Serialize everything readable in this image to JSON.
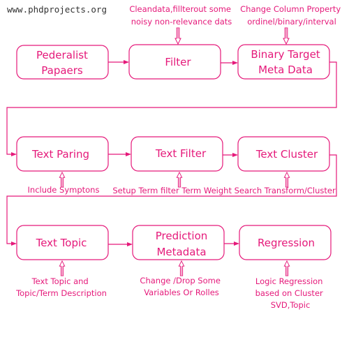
{
  "watermark": "www.phdprojects.org",
  "accent_color": "#e5197a",
  "nodes": [
    {
      "lines": [
        "Pederalist",
        "Papaers"
      ]
    },
    {
      "lines": [
        "Filter"
      ]
    },
    {
      "lines": [
        "Binary Target",
        "Meta Data"
      ]
    },
    {
      "lines": [
        "Text Paring"
      ]
    },
    {
      "lines": [
        "Text Filter"
      ]
    },
    {
      "lines": [
        "Text Cluster"
      ]
    },
    {
      "lines": [
        "Text Topic"
      ]
    },
    {
      "lines": [
        "Prediction",
        "Metadata"
      ]
    },
    {
      "lines": [
        "Regression"
      ]
    }
  ],
  "notes": {
    "filter": [
      "Cleandata,fillterout some",
      "noisy non-relevance dats"
    ],
    "binary": [
      "Change Column Property",
      "ordinel/binary/interval"
    ],
    "paring": [
      "Include Symptons"
    ],
    "row2": [
      "Setup Term filter Term Weight Search Transform/Cluster"
    ],
    "topic": [
      "Text Topic and",
      "Topic/Term Description"
    ],
    "prediction": [
      "Change /Drop Some",
      "Variables Or Rolles"
    ],
    "regression": [
      "Logic Regression",
      "based on Cluster",
      "SVD,Topic"
    ]
  }
}
